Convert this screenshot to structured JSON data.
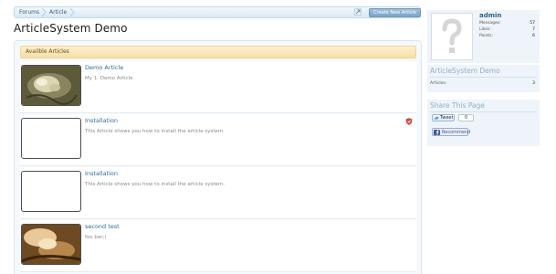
{
  "breadcrumb": {
    "items": [
      "Forums",
      "Article"
    ]
  },
  "toolbar": {
    "create_label": "Create New Article"
  },
  "page": {
    "title": "ArticleSystem Demo"
  },
  "panel": {
    "heading": "Availble Articles"
  },
  "articles": [
    {
      "title": "Demo Article",
      "description": "My 1. Demo Article",
      "thumb": "photo-nest"
    },
    {
      "title": "Installation",
      "description": "This Article shows you how to install the article system",
      "thumb": "empty",
      "badge": "shield-icon"
    },
    {
      "title": "Installation",
      "description": "This Article shows you how to install the article system.",
      "thumb": "empty"
    },
    {
      "title": "second test",
      "description": "foo bar;)",
      "thumb": "photo-gold"
    }
  ],
  "user": {
    "name": "admin",
    "stats": [
      {
        "label": "Messages:",
        "value": "57"
      },
      {
        "label": "Likes:",
        "value": "7"
      },
      {
        "label": "Points:",
        "value": "6"
      }
    ]
  },
  "system_box": {
    "heading": "ArticleSystem Demo",
    "label": "Articles:",
    "value": "3"
  },
  "share": {
    "heading": "Share This Page",
    "tweet_label": "Tweet",
    "tweet_count": "0",
    "fb_label": "Recommend"
  },
  "colors": {
    "link": "#2e6a9b",
    "panel_head": "#f7dfa8",
    "sidebar": "#eef4f9"
  }
}
